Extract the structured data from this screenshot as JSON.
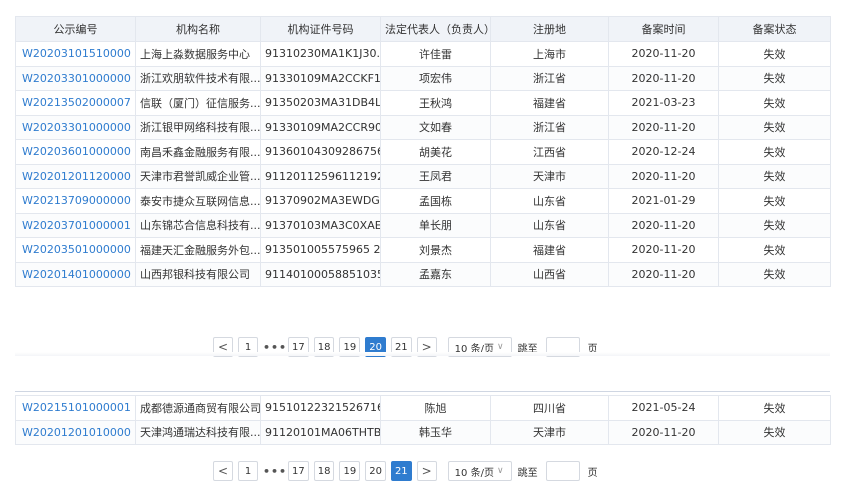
{
  "table": {
    "headers": [
      "公示编号",
      "机构名称",
      "机构证件号码",
      "法定代表人（负责人）",
      "注册地",
      "备案时间",
      "备案状态"
    ],
    "rows_page20": [
      [
        "W20203101510000",
        "上海上淼数据服务中心",
        "91310230MA1K1J30...",
        "许佳雷",
        "上海市",
        "2020-11-20",
        "失效"
      ],
      [
        "W20203301000000",
        "浙江欢朋软件技术有限...",
        "91330109MA2CCKF1...",
        "项宏伟",
        "浙江省",
        "2020-11-20",
        "失效"
      ],
      [
        "W20213502000007",
        "信联（厦门）征信服务...",
        "91350203MA31DB4L...",
        "王秋鸿",
        "福建省",
        "2021-03-23",
        "失效"
      ],
      [
        "W20203301000000",
        "浙江银甲网络科技有限...",
        "91330109MA2CCR90...",
        "文如春",
        "浙江省",
        "2020-11-20",
        "失效"
      ],
      [
        "W20203601000000",
        "南昌禾鑫金融服务有限...",
        "913601043092867567",
        "胡美花",
        "江西省",
        "2020-12-24",
        "失效"
      ],
      [
        "W20201201120000",
        "天津市君誉凯威企业管...",
        "91120112596112192J",
        "王凤君",
        "天津市",
        "2020-11-20",
        "失效"
      ],
      [
        "W20213709000000",
        "泰安市捷众互联网信息...",
        "91370902MA3EWDG...",
        "孟国栋",
        "山东省",
        "2021-01-29",
        "失效"
      ],
      [
        "W20203701000001",
        "山东锦芯合信息科技有...",
        "91370103MA3C0XAE...",
        "单长朋",
        "山东省",
        "2020-11-20",
        "失效"
      ],
      [
        "W20203501000000",
        "福建天汇金融服务外包...",
        "913501005575965 26Y",
        "刘景杰",
        "福建省",
        "2020-11-20",
        "失效"
      ],
      [
        "W20201401000000",
        "山西邦银科技有限公司",
        "911401000588510351",
        "孟嘉东",
        "山西省",
        "2020-11-20",
        "失效"
      ]
    ],
    "rows_page21": [
      [
        "W20215101000001",
        "成都德源通商贸有限公司",
        "91510122321526716R",
        "陈旭",
        "四川省",
        "2021-05-24",
        "失效"
      ],
      [
        "W20201201010000",
        "天津鸿通瑞达科技有限...",
        "91120101MA06THTB...",
        "韩玉华",
        "天津市",
        "2020-11-20",
        "失效"
      ]
    ]
  },
  "pager1": {
    "prev": "<",
    "first": "1",
    "ellipsis": "•••",
    "pages": [
      "17",
      "18",
      "19",
      "20",
      "21"
    ],
    "active": "20",
    "next": ">",
    "page_size": "10 条/页",
    "jump_label": "跳至",
    "page_unit": "页"
  },
  "pager2": {
    "prev": "<",
    "first": "1",
    "ellipsis": "•••",
    "pages": [
      "17",
      "18",
      "19",
      "20",
      "21"
    ],
    "active": "21",
    "next": ">",
    "page_size": "10 条/页",
    "jump_label": "跳至",
    "page_unit": "页"
  },
  "colors": {
    "accent": "#2f7ccf",
    "header_bg": "#f0f3f8",
    "border": "#e3e7ee"
  },
  "icons": {
    "prev": "chevron-left-icon",
    "next": "chevron-right-icon",
    "dropdown": "chevron-down-icon"
  }
}
